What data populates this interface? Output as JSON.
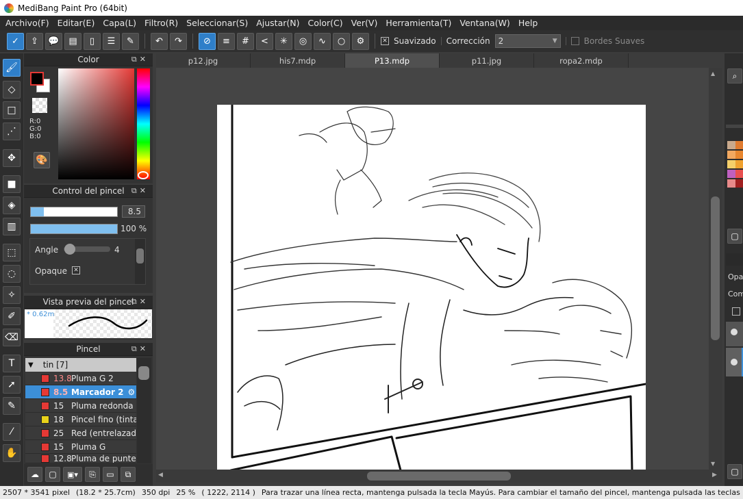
{
  "window": {
    "title": "MediBang Paint Pro (64bit)"
  },
  "menu": [
    "Archivo(F)",
    "Editar(E)",
    "Capa(L)",
    "Filtro(R)",
    "Seleccionar(S)",
    "Ajustar(N)",
    "Color(C)",
    "Ver(V)",
    "Herramienta(T)",
    "Ventana(W)",
    "Help"
  ],
  "toolbar": {
    "smoothing_label": "Suavizado",
    "smoothing_checked": true,
    "correction_label": "Corrección",
    "correction_value": "2",
    "soft_edges_label": "Bordes Suaves",
    "soft_edges_checked": false
  },
  "panels": {
    "color": {
      "title": "Color",
      "rgb": {
        "r": "R:0",
        "g": "G:0",
        "b": "B:0"
      },
      "foreground": "#000000",
      "background": "#ffffff",
      "hue_color": "#e53935"
    },
    "brush_control": {
      "title": "Control del pincel",
      "size_value": "8.5",
      "size_fraction": 0.15,
      "opacity_value": "100 %",
      "opacity_fraction": 1.0,
      "angle_label": "Angle",
      "angle_value": "4",
      "opaque_label": "Opaque",
      "opaque_checked": true
    },
    "brush_preview": {
      "title": "Vista previa del pincel",
      "size_text": "* 0.62m"
    },
    "brush_list": {
      "title": "Pincel",
      "group": "tin [7]",
      "items": [
        {
          "size": "13.8",
          "name": "Pluma G 2",
          "color": "#e53935",
          "selected": false
        },
        {
          "size": "8.5",
          "name": "Marcador 2",
          "color": "#e53935",
          "selected": true
        },
        {
          "size": "15",
          "name": "Pluma redonda",
          "color": "#e53935",
          "selected": false
        },
        {
          "size": "18",
          "name": "Pincel fino (tinta)",
          "color": "#e8d11a",
          "selected": false
        },
        {
          "size": "25",
          "name": "Red (entrelazado)",
          "color": "#e53935",
          "selected": false
        },
        {
          "size": "15",
          "name": "Pluma G",
          "color": "#e53935",
          "selected": false
        },
        {
          "size": "12.8",
          "name": "Pluma de punteo",
          "color": "#e53935",
          "selected": false
        }
      ]
    }
  },
  "tabs": [
    "p12.jpg",
    "his7.mdp",
    "P13.mdp",
    "p11.jpg",
    "ropa2.mdp"
  ],
  "active_tab": "P13.mdp",
  "right_panel": {
    "opacity_label": "Opa",
    "composite_label": "Com"
  },
  "status": {
    "dimensions": "2507 * 3541 pixel",
    "size_cm": "(18.2 * 25.7cm)",
    "dpi": "350 dpi",
    "zoom": "25 %",
    "coords": "( 1222, 2114 )",
    "hint": "Para trazar una línea recta, mantenga pulsada la tecla Mayús. Para cambiar el tamaño del pincel, mantenga pulsada las teclas Ctrl + Alt y arra"
  }
}
